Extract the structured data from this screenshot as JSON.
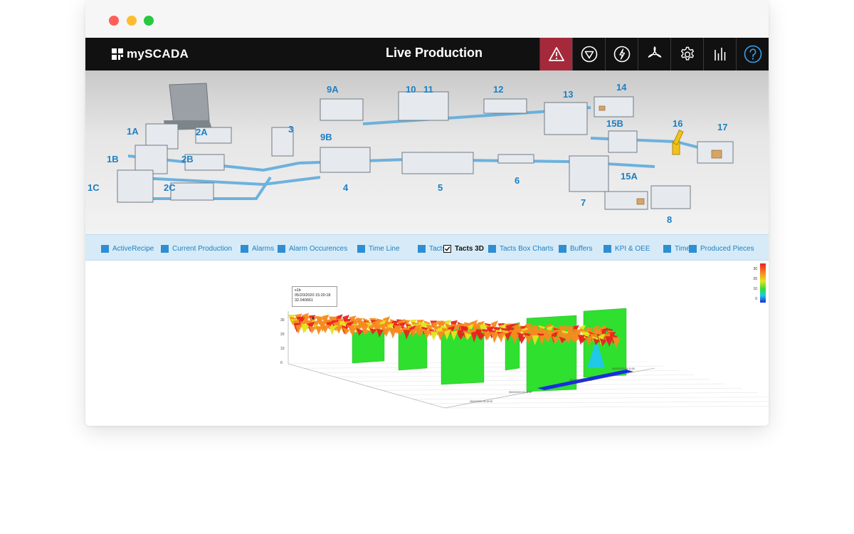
{
  "app": {
    "brand": "mySCADA",
    "title": "Live Production"
  },
  "toolbar": [
    {
      "name": "alarm-icon",
      "active": true
    },
    {
      "name": "stop-icon"
    },
    {
      "name": "power-icon"
    },
    {
      "name": "fan-icon"
    },
    {
      "name": "gear-icon"
    },
    {
      "name": "bar-chart-icon"
    },
    {
      "name": "help-icon"
    }
  ],
  "stations": [
    "1A",
    "1B",
    "1C",
    "2A",
    "2B",
    "2C",
    "3",
    "4",
    "5",
    "6",
    "7",
    "8",
    "9A",
    "9B",
    "10",
    "11",
    "12",
    "13",
    "14",
    "15A",
    "15B",
    "16",
    "17"
  ],
  "tabs": [
    {
      "label": "ActiveRecipe",
      "checked": false
    },
    {
      "label": "Current Production",
      "checked": false
    },
    {
      "label": "Alarms",
      "checked": false
    },
    {
      "label": "Alarm Occurences",
      "checked": false
    },
    {
      "label": "Time Line",
      "checked": false
    },
    {
      "label": "Tacts",
      "checked": false
    },
    {
      "label": "Tacts 3D",
      "checked": true
    },
    {
      "label": "Tacts Box Charts",
      "checked": false
    },
    {
      "label": "Buffers",
      "checked": false
    },
    {
      "label": "KPI & OEE",
      "checked": false
    },
    {
      "label": "Times",
      "checked": false
    },
    {
      "label": "Produced Pieces",
      "checked": false
    }
  ],
  "chart_data": {
    "type": "surface3d",
    "tooltip": {
      "series": "s1b",
      "time": "05/20/2020 15:20:18",
      "value": "32.040661"
    },
    "z_ticks": [
      "30",
      "20",
      "10",
      "0"
    ],
    "colorscale": {
      "ticks": [
        "30",
        "20",
        "10",
        "0"
      ],
      "colors": [
        "#e8231f",
        "#f68a1f",
        "#e4e51c",
        "#2fe02f",
        "#20c8e8",
        "#1a2ce0"
      ]
    },
    "x_ticks": [
      "05/20/2020 15:10:00",
      "05/20/2020 15:15:00",
      "05/20/2020 15:14:00",
      "05/20/2020 15:11:00"
    ]
  }
}
